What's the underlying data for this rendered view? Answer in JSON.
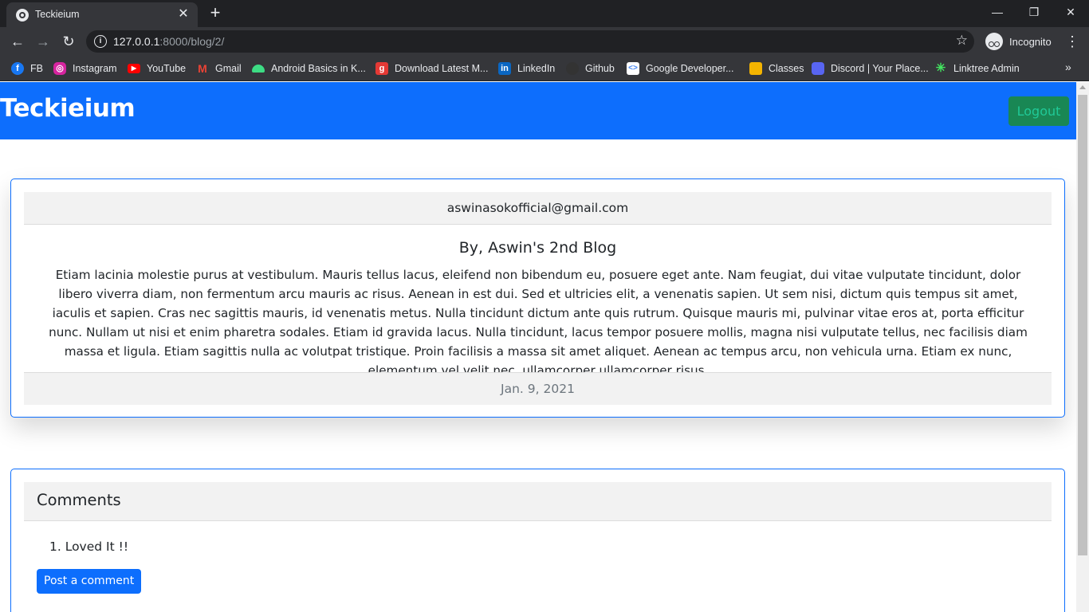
{
  "browser": {
    "tab_title": "Teckieium",
    "url_host": "127.0.0.1",
    "url_path": ":8000/blog/2/",
    "profile_label": "Incognito",
    "bookmarks": [
      {
        "label": "FB",
        "icon": "facebook-icon",
        "color": "#1877f2"
      },
      {
        "label": "Instagram",
        "icon": "instagram-icon",
        "color": "#d6249f"
      },
      {
        "label": "YouTube",
        "icon": "youtube-icon",
        "color": "#ff0000"
      },
      {
        "label": "Gmail",
        "icon": "gmail-icon",
        "color": "#ea4335"
      },
      {
        "label": "Android Basics in K...",
        "icon": "android-icon",
        "color": "#3ddc84"
      },
      {
        "label": "Download Latest M...",
        "icon": "download-icon",
        "color": "#e53935"
      },
      {
        "label": "LinkedIn",
        "icon": "linkedin-icon",
        "color": "#0a66c2"
      },
      {
        "label": "Github",
        "icon": "github-icon",
        "color": "#333333"
      },
      {
        "label": "Google Developer...",
        "icon": "google-dev-icon",
        "color": "#ffffff"
      },
      {
        "label": "Classes",
        "icon": "classroom-icon",
        "color": "#f4b400"
      },
      {
        "label": "Discord | Your Place...",
        "icon": "discord-icon",
        "color": "#5865f2"
      },
      {
        "label": "Linktree Admin",
        "icon": "linktree-icon",
        "color": "#43e660"
      }
    ]
  },
  "navbar": {
    "brand": "Teckieium",
    "logout_label": "Logout"
  },
  "blog": {
    "author_email": "aswinasokofficial@gmail.com",
    "title": "By, Aswin's 2nd Blog",
    "body": "Etiam lacinia molestie purus at vestibulum. Mauris tellus lacus, eleifend non bibendum eu, posuere eget ante. Nam feugiat, dui vitae vulputate tincidunt, dolor libero viverra diam, non fermentum arcu mauris ac risus. Aenean in est dui. Sed et ultricies elit, a venenatis sapien. Ut sem nisi, dictum quis tempus sit amet, iaculis et sapien. Cras nec sagittis mauris, id venenatis metus. Nulla tincidunt dictum ante quis rutrum. Quisque mauris mi, pulvinar vitae eros at, porta efficitur nunc. Nullam ut nisi et enim pharetra sodales. Etiam id gravida lacus. Nulla tincidunt, lacus tempor posuere mollis, magna nisi vulputate tellus, nec facilisis diam massa et ligula. Etiam sagittis nulla ac volutpat tristique. Proin facilisis a massa sit amet aliquet. Aenean ac tempus arcu, non vehicula urna. Etiam ex nunc, elementum vel velit nec, ullamcorper ullamcorper risus.",
    "date": "Jan. 9, 2021"
  },
  "comments": {
    "title": "Comments",
    "items": [
      "1. Loved It !!"
    ],
    "post_label": "Post a comment"
  },
  "colors": {
    "primary": "#0d6efd",
    "success": "#198754"
  }
}
